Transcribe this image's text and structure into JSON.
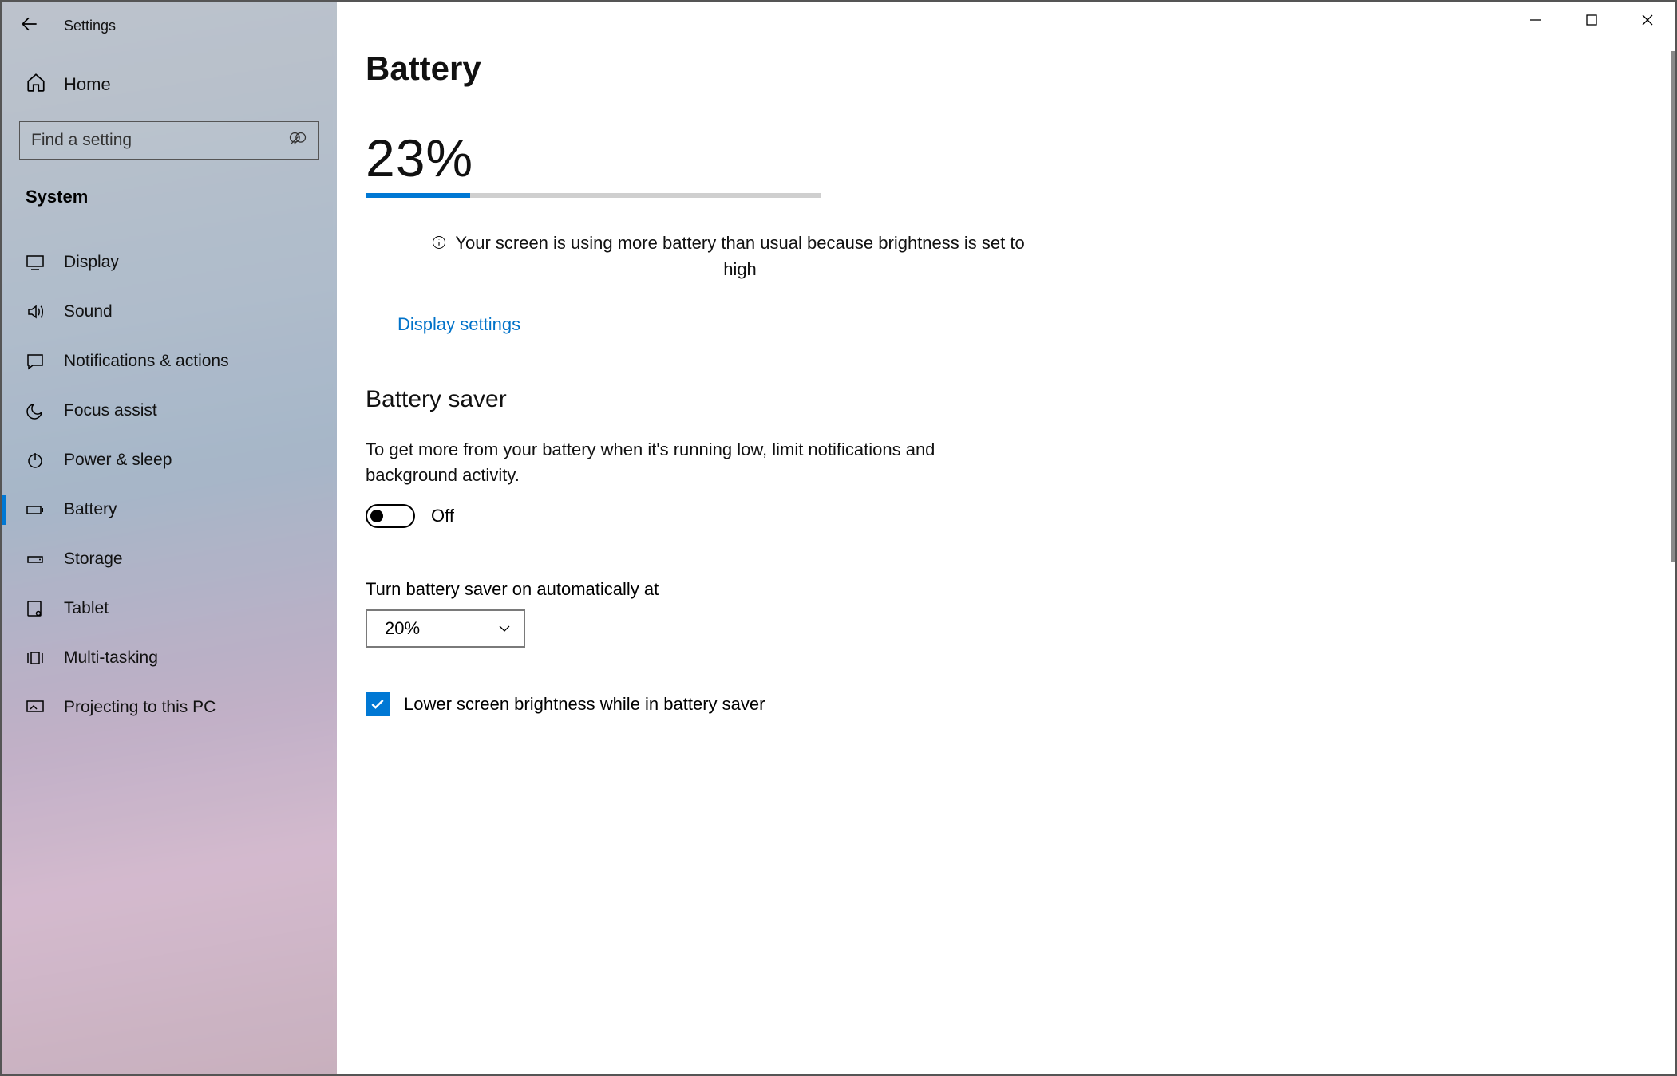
{
  "window": {
    "title": "Settings"
  },
  "sidebar": {
    "home": "Home",
    "search_placeholder": "Find a setting",
    "category": "System",
    "items": [
      {
        "label": "Display",
        "icon": "monitor-icon"
      },
      {
        "label": "Sound",
        "icon": "speaker-icon"
      },
      {
        "label": "Notifications & actions",
        "icon": "message-icon"
      },
      {
        "label": "Focus assist",
        "icon": "moon-icon"
      },
      {
        "label": "Power & sleep",
        "icon": "power-icon"
      },
      {
        "label": "Battery",
        "icon": "battery-icon"
      },
      {
        "label": "Storage",
        "icon": "drive-icon"
      },
      {
        "label": "Tablet",
        "icon": "tablet-icon"
      },
      {
        "label": "Multi-tasking",
        "icon": "multitask-icon"
      },
      {
        "label": "Projecting to this PC",
        "icon": "project-icon"
      }
    ]
  },
  "main": {
    "title": "Battery",
    "battery_percent_text": "23%",
    "battery_percent_value": 23,
    "info_text": "Your screen is using more battery than usual because brightness is set to high",
    "link": "Display settings",
    "saver_heading": "Battery saver",
    "saver_desc": "To get more from your battery when it's running low, limit notifications and background activity.",
    "saver_toggle_state": "Off",
    "auto_label": "Turn battery saver on automatically at",
    "auto_value": "20%",
    "lower_brightness_label": "Lower screen brightness while in battery saver",
    "lower_brightness_checked": true
  },
  "colors": {
    "accent": "#0078d4",
    "link": "#0072c9"
  }
}
